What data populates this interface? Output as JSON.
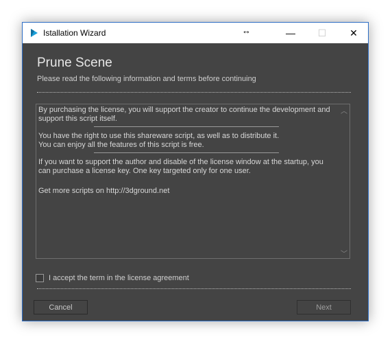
{
  "window": {
    "title": "Istallation Wizard",
    "resize_glyph": "↔",
    "minimize_glyph": "—",
    "maximize_glyph": "☐",
    "close_glyph": "✕"
  },
  "page": {
    "heading": "Prune Scene",
    "subheading": "Please read the following information and terms before continuing"
  },
  "license": {
    "paragraphs": [
      "By purchasing the license, you will support the creator  to continue the development and\nsupport this script itself.",
      "You have the right to use this shareware script, as well as to distribute it.\nYou can enjoy all the features of this script is free.",
      "If you want to support the author and disable of the license window at the startup, you\ncan purchase a license key. One key targeted only for one user.",
      "Get more scripts on http://3dground.net"
    ],
    "scroll_up_glyph": "︿",
    "scroll_down_glyph": "﹀"
  },
  "agreement": {
    "label": "I accept the term in the license agreement",
    "checked": false
  },
  "buttons": {
    "cancel": "Cancel",
    "next": "Next"
  },
  "colors": {
    "window_border": "#2b6cc4",
    "background": "#444444",
    "text": "#d7d7d7",
    "app_icon": "#1a9fd8"
  }
}
